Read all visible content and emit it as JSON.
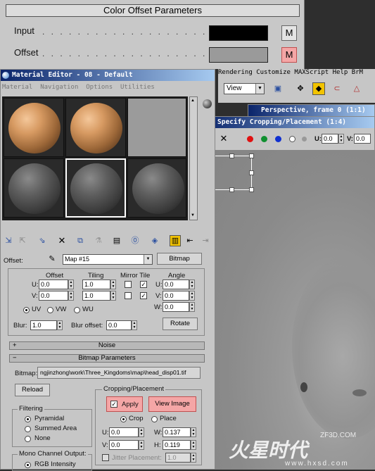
{
  "color_offset": {
    "title": "Color Offset Parameters",
    "input_label": "Input",
    "offset_label": "Offset",
    "dots": ". . . . . . . . . . . . . . . . . . .",
    "m_label": "M",
    "input_color": "#000000",
    "offset_color": "#9a9a9a"
  },
  "material_editor": {
    "title": "Material Editor - 08 - Default",
    "menus": [
      "Material",
      "Navigation",
      "Options",
      "Utilities"
    ],
    "offset_label": "Offset:",
    "map_name": "Map #15",
    "map_type": "Bitmap",
    "coords": {
      "offset_header": "Offset",
      "tiling_header": "Tiling",
      "mirror_tile_header": "Mirror Tile",
      "angle_header": "Angle",
      "u_label": "U:",
      "v_label": "V:",
      "w_label": "W:",
      "u_offset": "0.0",
      "v_offset": "0.0",
      "u_tiling": "1.0",
      "v_tiling": "1.0",
      "u_angle": "0.0",
      "v_angle": "0.0",
      "w_angle": "0.0",
      "uv": "UV",
      "vw": "VW",
      "wu": "WU",
      "blur_label": "Blur:",
      "blur": "1.0",
      "blur_offset_label": "Blur offset:",
      "blur_offset": "0.0",
      "rotate": "Rotate"
    },
    "noise_rollout": "Noise",
    "bitmap_rollout": "Bitmap Parameters",
    "bitmap_label": "Bitmap:",
    "bitmap_path": "ngjinzhong\\work\\Three_Kingdoms\\map\\head_disp01.tif",
    "reload": "Reload",
    "cropping_header": "Cropping/Placement",
    "apply": "Apply",
    "view_image": "View Image",
    "crop": "Crop",
    "place": "Place",
    "u_val": "0.0",
    "v_val": "0.0",
    "w_val": "0.137",
    "h_val": "0.119",
    "h_label": "H:",
    "jitter_label": "Jitter Placement:",
    "jitter_val": "1.0",
    "filtering_header": "Filtering",
    "filter_pyramidal": "Pyramidal",
    "filter_summed": "Summed Area",
    "filter_none": "None",
    "mono_header": "Mono Channel Output:",
    "mono_rgb": "RGB Intensity"
  },
  "max_menu": [
    "Rendering",
    "Customize",
    "MAXScript",
    "Help",
    "BrM"
  ],
  "view_dropdown": "View",
  "perspective_title": "Perspective, frame 0 (1:1)",
  "crop_window": {
    "title": "Specify Cropping/Placement (1:4)",
    "u_label": "U:",
    "u_val": "0.0",
    "v_label": "V:",
    "v_val": "0.0"
  },
  "watermark": {
    "brand": "火星时代",
    "url": "www.hxsd.com",
    "sub": "ZF3D.COM"
  }
}
